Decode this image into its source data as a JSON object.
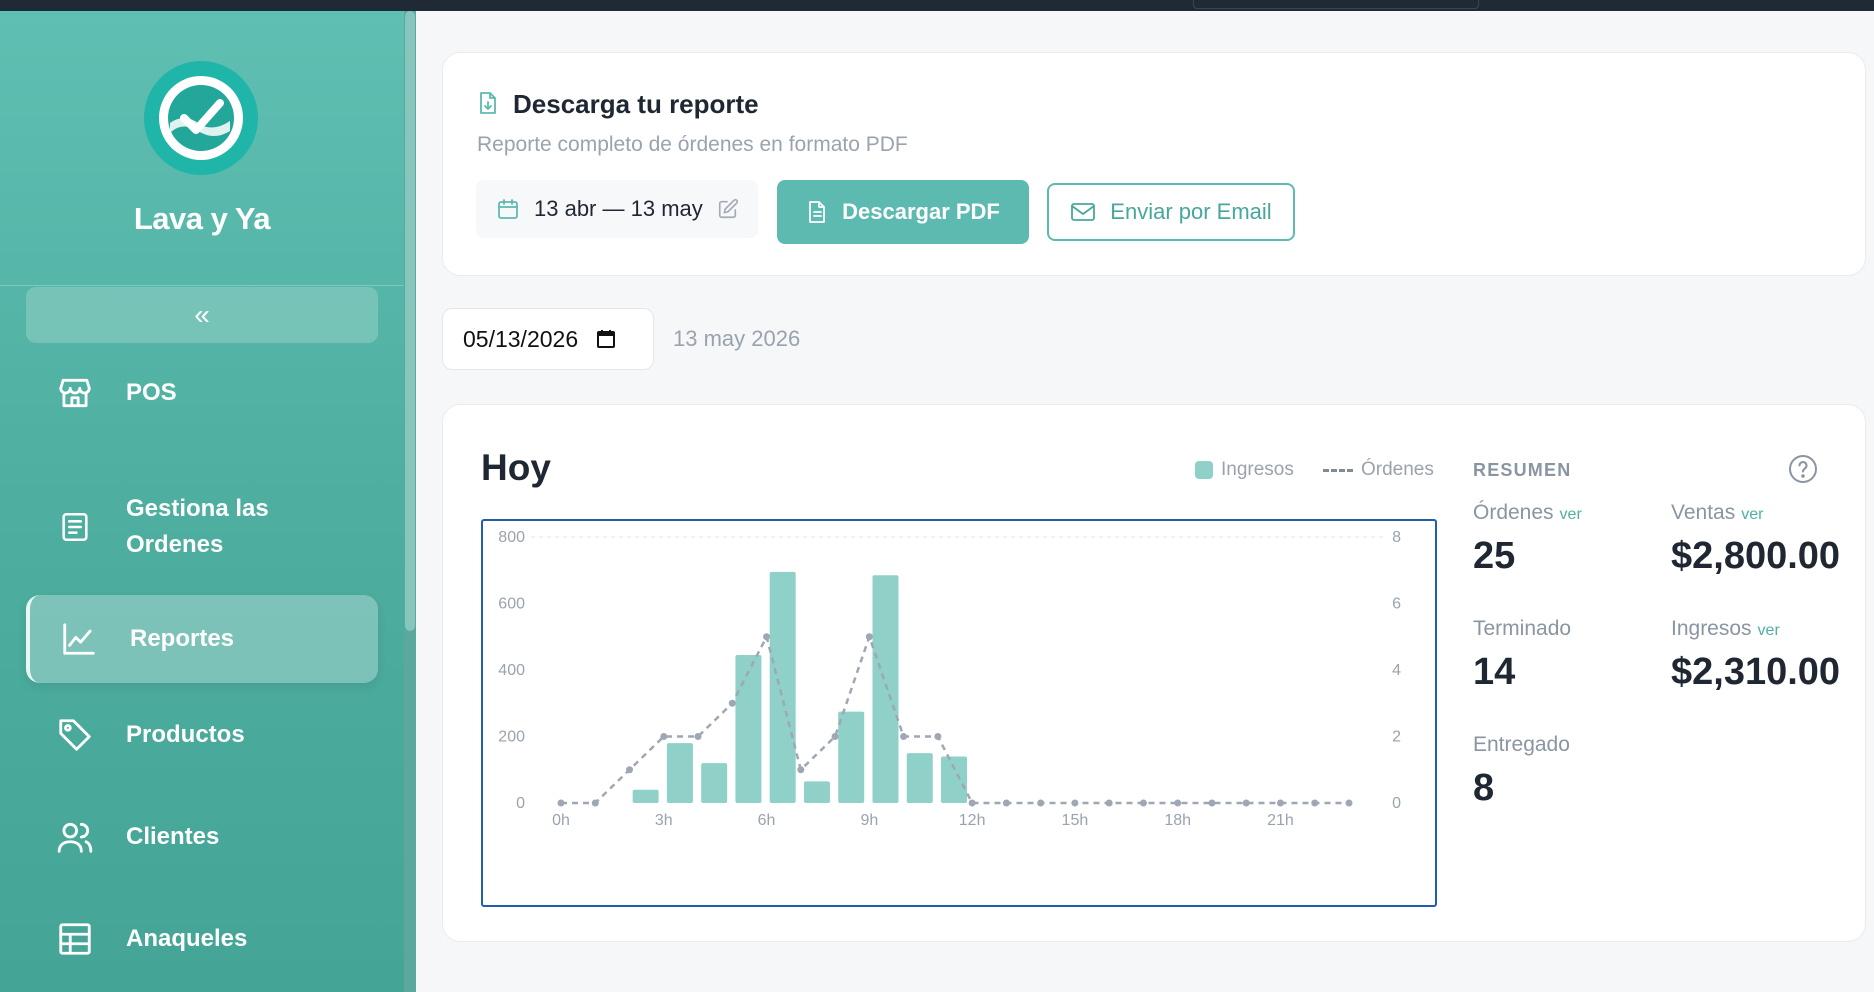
{
  "brand": {
    "name": "Lava y Ya"
  },
  "sidebar": {
    "collapse_label": "«",
    "items": [
      {
        "label": "POS",
        "icon": "store-icon"
      },
      {
        "label": "Gestiona las Ordenes",
        "label_line1": "Gestiona las",
        "label_line2": "Ordenes",
        "icon": "receipt-icon"
      },
      {
        "label": "Reportes",
        "icon": "chart-line-icon",
        "active": true
      },
      {
        "label": "Productos",
        "icon": "tag-icon"
      },
      {
        "label": "Clientes",
        "icon": "users-icon"
      },
      {
        "label": "Anaqueles",
        "icon": "table-grid-icon"
      }
    ]
  },
  "report": {
    "title": "Descarga tu reporte",
    "subtitle": "Reporte completo de órdenes en formato PDF",
    "range": "13 abr — 13 may",
    "download_label": "Descargar PDF",
    "email_label": "Enviar por Email"
  },
  "date_filter": {
    "value": "05/13/2026",
    "label": "13 may 2026"
  },
  "today": {
    "title": "Hoy",
    "legend_ingresos": "Ingresos",
    "legend_ordenes": "Órdenes"
  },
  "summary": {
    "title": "RESUMEN",
    "ver": "ver",
    "ordenes_label": "Órdenes",
    "ordenes_value": "25",
    "ventas_label": "Ventas",
    "ventas_value": "$2,800.00",
    "terminado_label": "Terminado",
    "terminado_value": "14",
    "ingresos_label": "Ingresos",
    "ingresos_value": "$2,310.00",
    "entregado_label": "Entregado",
    "entregado_value": "8"
  },
  "colors": {
    "accent": "#5dbab0",
    "bar": "#8fd1c8",
    "line": "#9ea7b3",
    "chart_border": "#1f5ea8"
  },
  "chart_data": {
    "type": "bar",
    "categories": [
      "0h",
      "1h",
      "2h",
      "3h",
      "4h",
      "5h",
      "6h",
      "7h",
      "8h",
      "9h",
      "10h",
      "11h",
      "12h",
      "13h",
      "14h",
      "15h",
      "16h",
      "17h",
      "18h",
      "19h",
      "20h",
      "21h",
      "22h",
      "23h"
    ],
    "x_tick_labels": [
      "0h",
      "3h",
      "6h",
      "9h",
      "12h",
      "15h",
      "18h",
      "21h"
    ],
    "y_left_ticks": [
      "0",
      "200",
      "400",
      "600",
      "800"
    ],
    "y_right_ticks": [
      "0",
      "2",
      "4",
      "6",
      "8"
    ],
    "ylim_left": [
      0,
      800
    ],
    "ylim_right": [
      0,
      8
    ],
    "series": [
      {
        "name": "Ingresos",
        "type": "bar",
        "axis": "left",
        "values": [
          0,
          0,
          40,
          180,
          120,
          445,
          695,
          65,
          275,
          685,
          150,
          140,
          0,
          0,
          0,
          0,
          0,
          0,
          0,
          0,
          0,
          0,
          0,
          0
        ]
      },
      {
        "name": "Órdenes",
        "type": "line",
        "axis": "right",
        "style": "dashed",
        "values": [
          0,
          0,
          1,
          2,
          2,
          3,
          5,
          1,
          2,
          5,
          2,
          2,
          0,
          0,
          0,
          0,
          0,
          0,
          0,
          0,
          0,
          0,
          0,
          0
        ]
      }
    ],
    "grid": "top-dashed"
  }
}
